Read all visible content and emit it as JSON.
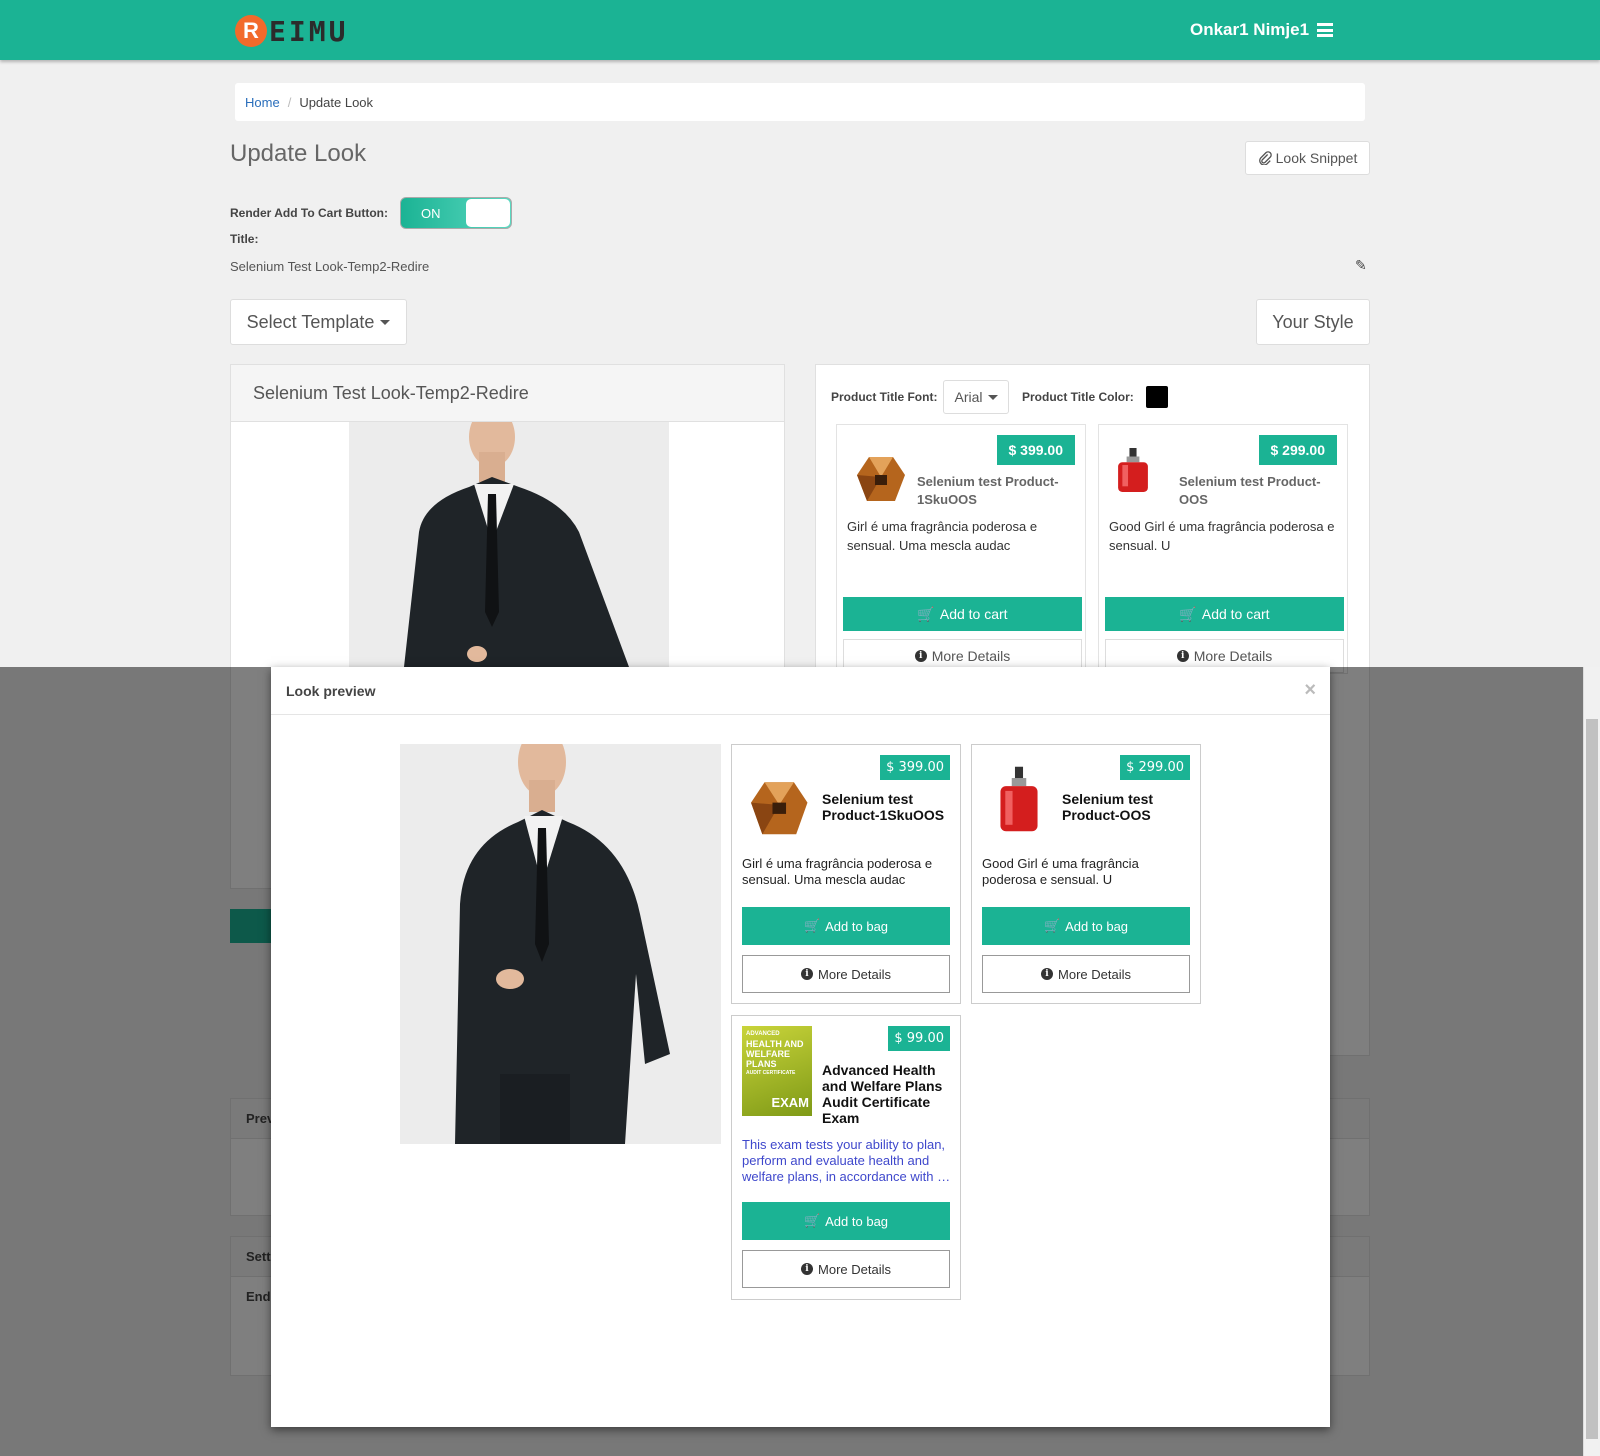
{
  "header": {
    "logo_letter": "R",
    "logo_text": "EIMU",
    "user_name": "Onkar1 Nimje1"
  },
  "breadcrumb": {
    "home": "Home",
    "current": "Update Look"
  },
  "page": {
    "title": "Update Look",
    "snippet_button": "Look Snippet",
    "render_cart_label": "Render Add To Cart Button:",
    "toggle_state": "ON",
    "title_label": "Title:",
    "title_value": "Selenium Test Look-Temp2-Redire",
    "select_template": "Select Template",
    "your_style": "Your Style"
  },
  "look_panel": {
    "heading": "Selenium Test Look-Temp2-Redire"
  },
  "style_panel": {
    "font_label": "Product Title Font:",
    "font_value": "Arial",
    "color_label": "Product Title Color:",
    "color_value": "#000000",
    "products": [
      {
        "price": "$ 399.00",
        "title": "Selenium test Product-1SkuOOS",
        "description": "Girl é uma fragrância poderosa e sensual. Uma mescla audac",
        "cart_label": "Add to cart",
        "more_label": "More Details"
      },
      {
        "price": "$ 299.00",
        "title": "Selenium test Product-OOS",
        "description": "Good Girl é uma fragrância poderosa e sensual. U",
        "cart_label": "Add to cart",
        "more_label": "More Details"
      }
    ]
  },
  "background_sections": {
    "preview_label": "Prev",
    "settings_label": "Sett",
    "endpoint_label": "Endp"
  },
  "modal": {
    "title": "Look preview",
    "close": "×",
    "products": [
      {
        "price": "$ 399.00",
        "title": "Selenium test Product-1SkuOOS",
        "description": "Girl é uma fragrância poderosa e sensual. Uma mescla audac",
        "bag_label": "Add to bag",
        "more_label": "More Details"
      },
      {
        "price": "$ 299.00",
        "title": "Selenium test Product-OOS",
        "description": "Good Girl é uma fragrância poderosa e sensual. U",
        "bag_label": "Add to bag",
        "more_label": "More Details"
      },
      {
        "price": "$ 99.00",
        "title": "Advanced Health and Welfare Plans Audit Certificate Exam",
        "description": "This exam tests your ability to plan, perform and evaluate health and welfare plans, in accordance with …",
        "bag_label": "Add to bag",
        "more_label": "More Details",
        "image_text_top": "ADVANCED",
        "image_text_mid": "HEALTH AND WELFARE PLANS",
        "image_text_sub": "AUDIT CERTIFICATE",
        "image_text_bottom": "EXAM"
      }
    ]
  },
  "colors": {
    "brand": "#1bb394",
    "logo_accent": "#f26a2b",
    "link": "#2a6ebb"
  }
}
